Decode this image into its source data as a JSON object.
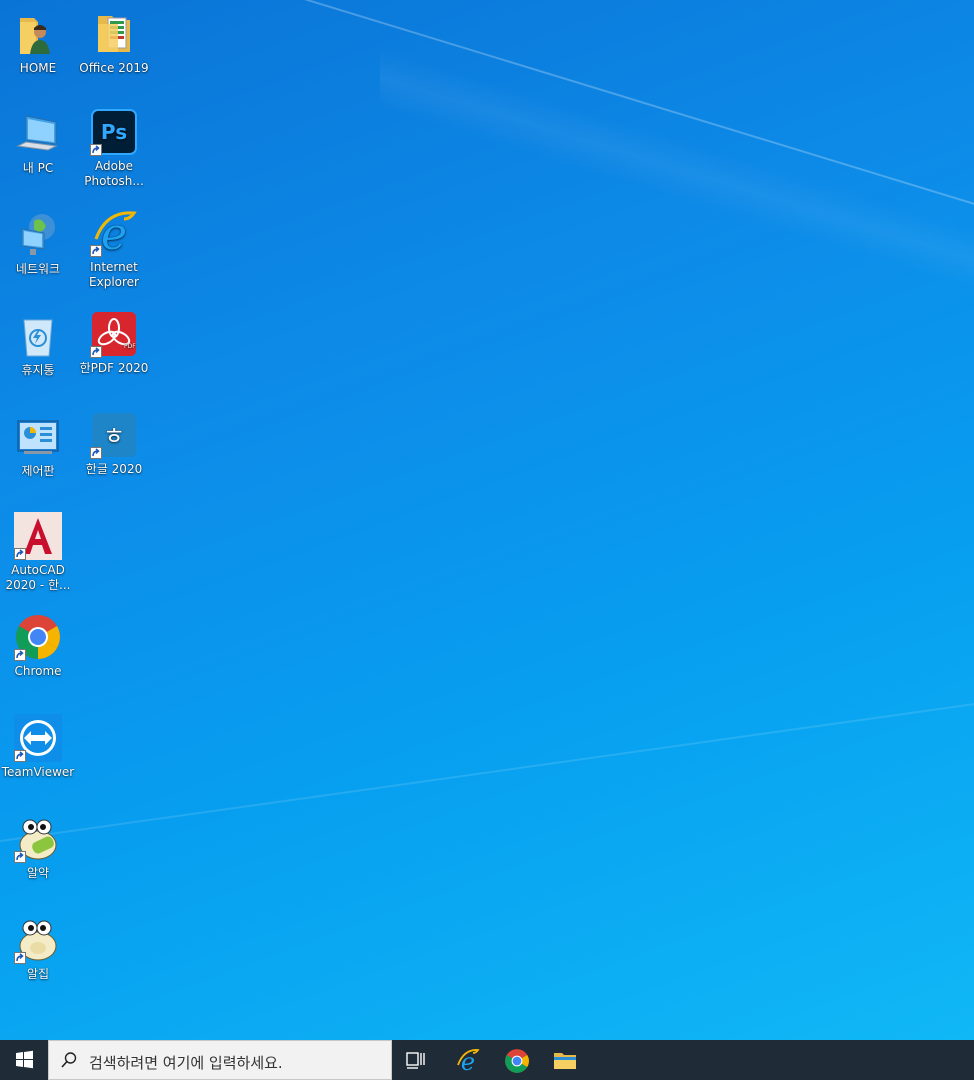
{
  "desktop": {
    "icons": [
      {
        "label": "HOME"
      },
      {
        "label": "Office 2019"
      },
      {
        "label": "내 PC"
      },
      {
        "label": "Adobe Photosh..."
      },
      {
        "label": "네트워크"
      },
      {
        "label": "Internet Explorer"
      },
      {
        "label": "휴지통"
      },
      {
        "label": "한PDF 2020"
      },
      {
        "label": "제어판"
      },
      {
        "label": "한글 2020"
      },
      {
        "label": "AutoCAD 2020 - 한..."
      },
      {
        "label": "Chrome"
      },
      {
        "label": "TeamViewer"
      },
      {
        "label": "알약"
      },
      {
        "label": "알집"
      }
    ]
  },
  "taskbar": {
    "search_placeholder": "검색하려면 여기에 입력하세요.",
    "pinned": [
      {
        "icon": "task-view-icon"
      },
      {
        "icon": "internet-explorer-icon"
      },
      {
        "icon": "chrome-icon"
      },
      {
        "icon": "file-explorer-icon"
      }
    ]
  },
  "colors": {
    "desktop_accent": "#0d8be8",
    "taskbar": "#1f2b36"
  }
}
